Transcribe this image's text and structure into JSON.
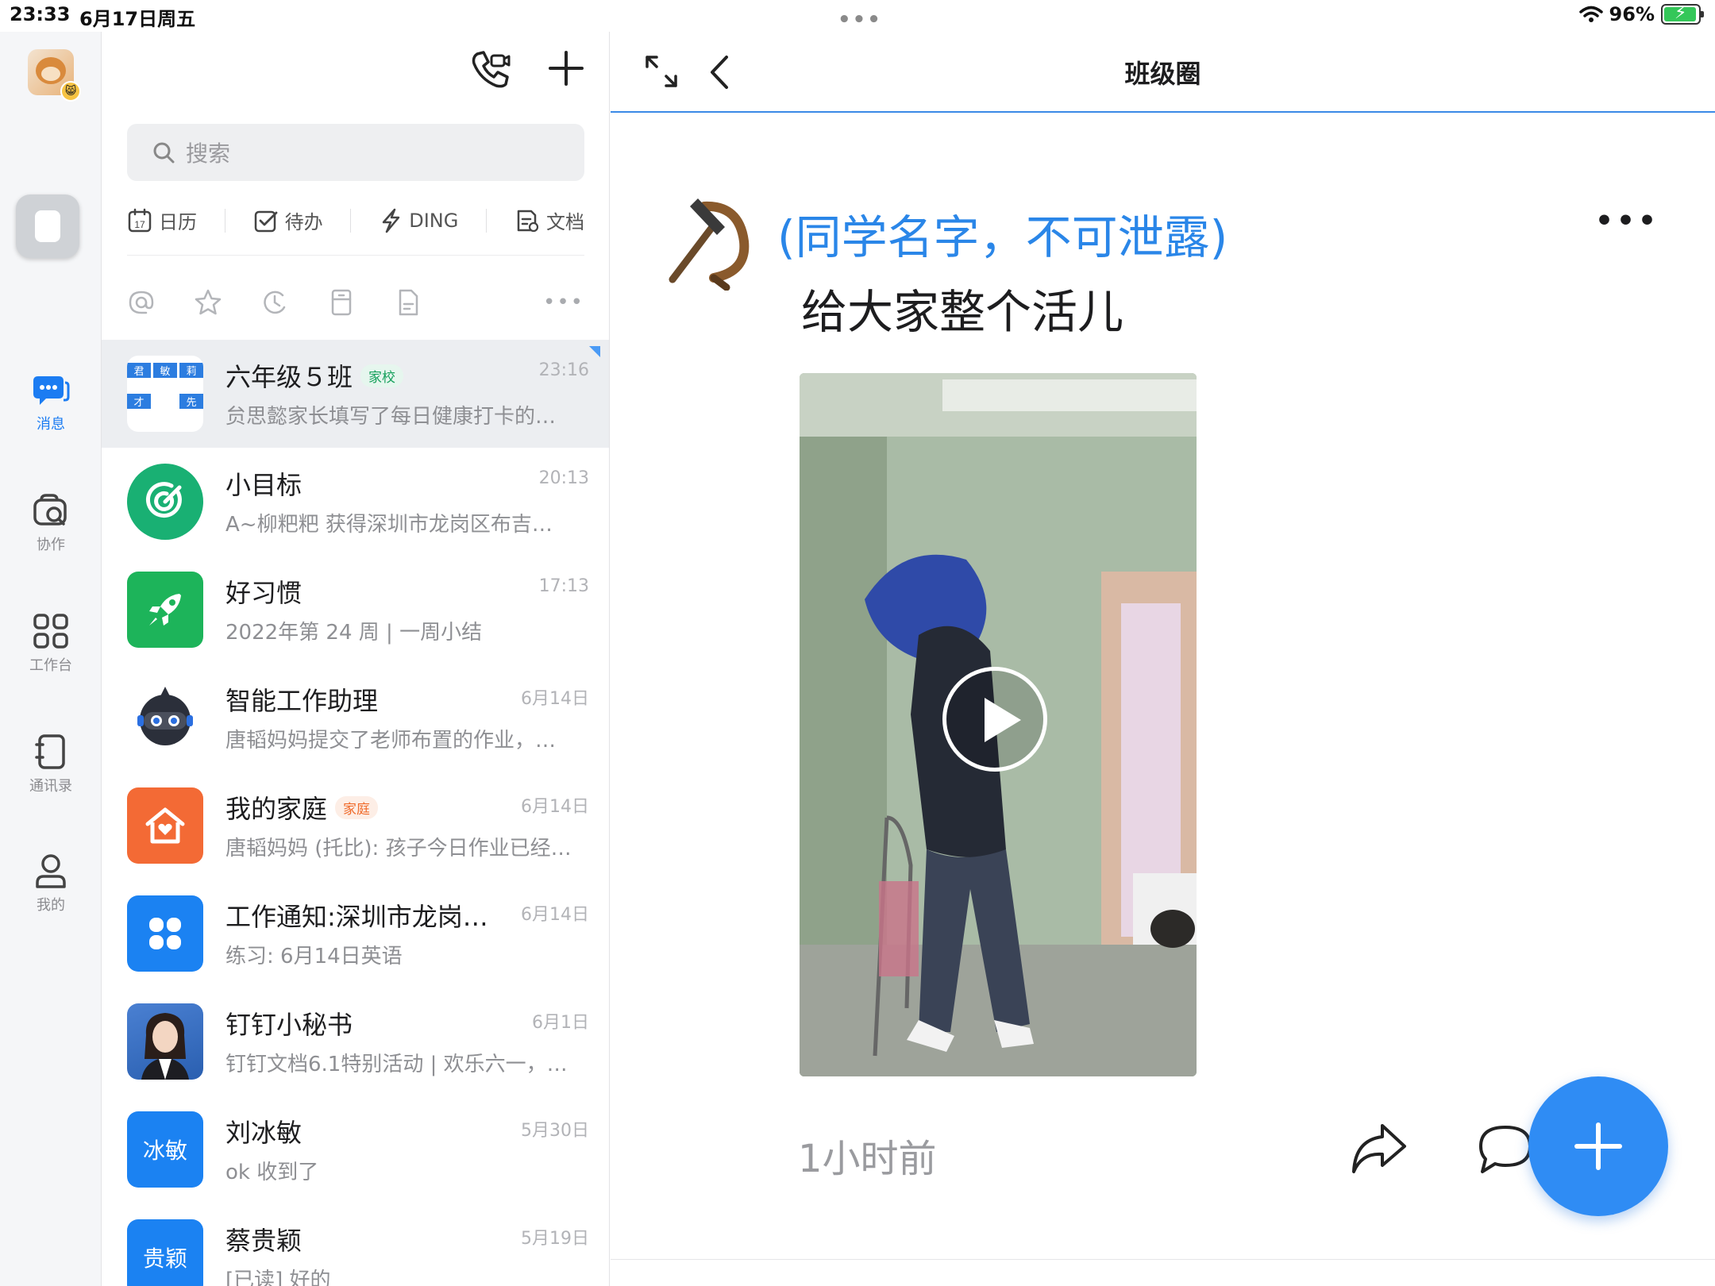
{
  "status_bar": {
    "time": "23:33",
    "date": "6月17日周五",
    "battery": "96%",
    "battery_level": 0.96
  },
  "rail": {
    "items": [
      {
        "label": "消息",
        "icon": "chat-bubbles-icon",
        "active": true
      },
      {
        "label": "协作",
        "icon": "collaboration-icon"
      },
      {
        "label": "工作台",
        "icon": "grid-icon"
      },
      {
        "label": "通讯录",
        "icon": "contacts-book-icon"
      },
      {
        "label": "我的",
        "icon": "person-icon"
      }
    ]
  },
  "list": {
    "search_placeholder": "搜索",
    "quick": [
      {
        "label": "日历",
        "icon": "calendar-icon",
        "day": "17"
      },
      {
        "label": "待办",
        "icon": "checkbox-icon"
      },
      {
        "label": "DING",
        "icon": "ding-icon"
      },
      {
        "label": "文档",
        "icon": "document-icon"
      }
    ],
    "filters": [
      "at-icon",
      "star-icon",
      "recent-icon",
      "archive-icon",
      "file-icon"
    ],
    "filters_more": "•••",
    "chats": [
      {
        "name": "六年级５班",
        "tag": "家校",
        "tag_color": "green",
        "time": "23:16",
        "preview": "贠思懿家长填写了每日健康打卡的…",
        "active": true,
        "avatar_color": "#2c7de0"
      },
      {
        "name": "小目标",
        "time": "20:13",
        "preview": "A~柳粑粑 获得深圳市龙岗区布吉…",
        "avatar_color": "#19b073"
      },
      {
        "name": "好习惯",
        "time": "17:13",
        "preview": "2022年第 24 周 | 一周小结",
        "avatar_color": "#1db45a"
      },
      {
        "name": "智能工作助理",
        "time": "6月14日",
        "preview": "唐韬妈妈提交了老师布置的作业，…",
        "avatar_color": "#ffffff"
      },
      {
        "name": "我的家庭",
        "tag": "家庭",
        "tag_color": "orange",
        "time": "6月14日",
        "preview": "唐韬妈妈 (托比): 孩子今日作业已经…",
        "avatar_color": "#f36a35"
      },
      {
        "name": "工作通知:深圳市龙岗…",
        "time": "6月14日",
        "preview": "练习: 6月14日英语",
        "avatar_color": "#1b82f2"
      },
      {
        "name": "钉钉小秘书",
        "time": "6月1日",
        "preview": "钉钉文档6.1特别活动 | 欢乐六一，…",
        "avatar_color": "#3b72c6"
      },
      {
        "name": "刘冰敏",
        "avatar_text": "冰敏",
        "time": "5月30日",
        "preview": "ok 收到了",
        "avatar_color": "#1b82f2"
      },
      {
        "name": "蔡贵颖",
        "avatar_text": "贵颖",
        "time": "5月19日",
        "preview": "[已读] 好的",
        "avatar_color": "#1b82f2"
      }
    ]
  },
  "detail": {
    "title": "班级圈",
    "post": {
      "user": "(同学名字，不可泄露)",
      "more": "•••",
      "text": "给大家整个活儿",
      "time": "1小时前"
    }
  }
}
